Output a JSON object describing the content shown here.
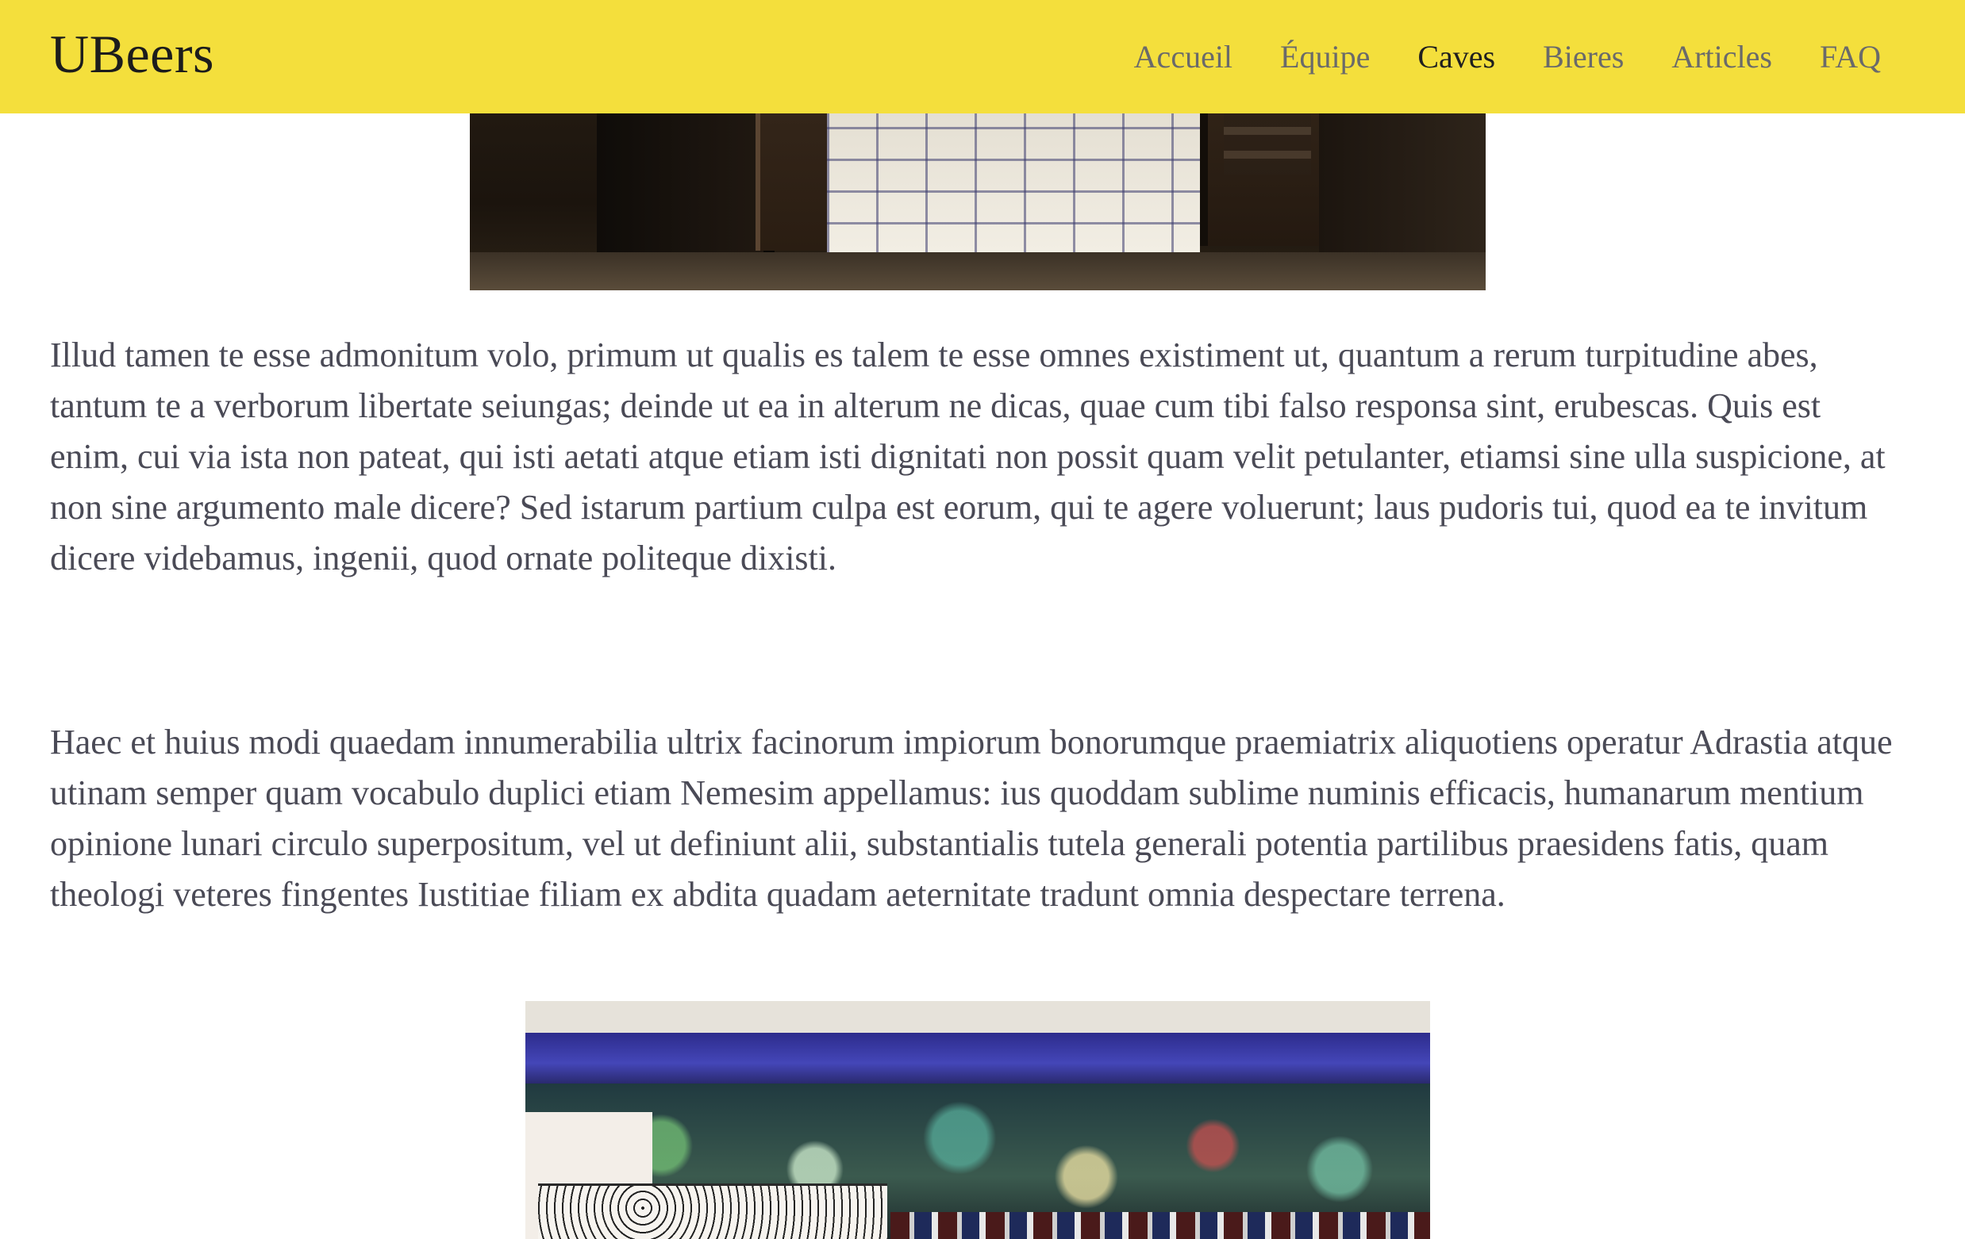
{
  "header": {
    "brand": "UBeers",
    "nav": [
      {
        "label": "Accueil",
        "active": false
      },
      {
        "label": "Équipe",
        "active": false
      },
      {
        "label": "Caves",
        "active": true
      },
      {
        "label": "Bieres",
        "active": false
      },
      {
        "label": "Articles",
        "active": false
      },
      {
        "label": "FAQ",
        "active": false
      }
    ]
  },
  "main": {
    "paragraphs": [
      "Illud tamen te esse admonitum volo, primum ut qualis es talem te esse omnes existiment ut, quantum a rerum turpitudine abes, tantum te a verborum libertate seiungas; deinde ut ea in alterum ne dicas, quae cum tibi falso responsa sint, erubescas. Quis est enim, cui via ista non pateat, qui isti aetati atque etiam isti dignitati non possit quam velit petulanter, etiamsi sine ulla suspicione, at non sine argumento male dicere? Sed istarum partium culpa est eorum, qui te agere voluerunt; laus pudoris tui, quod ea te invitum dicere videbamus, ingenii, quod ornate politeque dixisti.",
      "Haec et huius modi quaedam innumerabilia ultrix facinorum impiorum bonorumque praemiatrix aliquotiens operatur Adrastia atque utinam semper quam vocabulo duplici etiam Nemesim appellamus: ius quoddam sublime numinis efficacis, humanarum mentium opinione lunari circulo superpositum, vel ut definiunt alii, substantialis tutela generali potentia partilibus praesidens fatis, quam theologi veteres fingentes Iustitiae filiam ex abdita quadam aeternitate tradunt omnia despectare terrena."
    ]
  },
  "colors": {
    "header_bg": "#f4df3c",
    "brand_text": "#1c1c1c",
    "nav_text": "#6a6a6a",
    "nav_active_text": "#1f1f1f",
    "body_text": "#4a4a56"
  }
}
